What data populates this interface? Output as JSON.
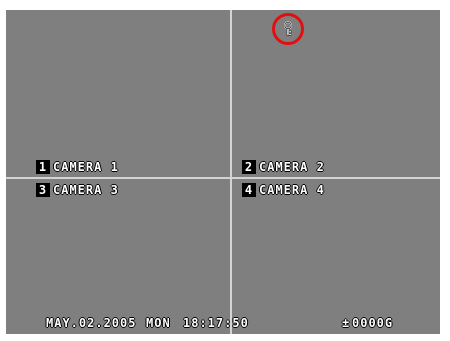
{
  "cameras": [
    {
      "number": "1",
      "name": "CAMERA 1"
    },
    {
      "number": "2",
      "name": "CAMERA 2"
    },
    {
      "number": "3",
      "name": "CAMERA 3"
    },
    {
      "number": "4",
      "name": "CAMERA 4"
    }
  ],
  "status_bar": {
    "date": "MAY.02.2005",
    "day": "MON",
    "time": "18:17:50",
    "disk_marker": "±",
    "disk_usage": "0000G"
  },
  "icons": {
    "top_indicator": "key-icon",
    "highlight_color": "#e01010"
  }
}
